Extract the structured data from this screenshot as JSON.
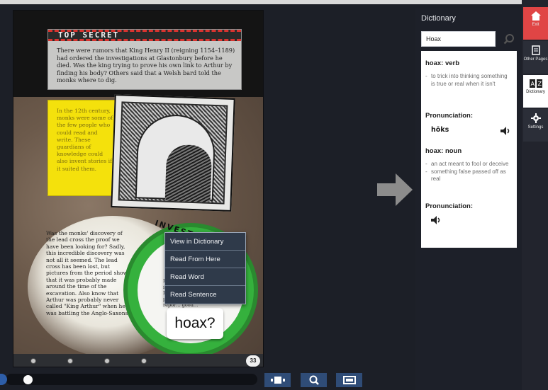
{
  "book": {
    "top_secret_title": "TOP SECRET",
    "top_secret_text": "There were rumors that King Henry II (reigning 1154–1189) had ordered the investigations at Glastonbury before he died. Was the king trying to prove his own link to Arthur by finding his body? Others said that a Welsh bard told the monks where to dig.",
    "sticky_note": "In the 12th century, monks were some of the few people who could read and write. These guardians of knowledge could also invent stories if it suited them.",
    "body_text": "Was the monks' discovery of the lead cross the proof we have been looking for? Sadly, this incredible discovery was not all it seemed. The lead cross has been lost, but pictures from the period show that it was probably made around the time of the excavation. Also know that Arthur was probably never called \"King Arthur\" when he was battling the Anglo-Saxons.",
    "investigation_title": "INVESTIGATION",
    "investigation_lines": "In th… In 11… recen… Disco… was … peopl… repor… good…",
    "selected_word": "hoax?",
    "page_number": "33"
  },
  "context_menu": {
    "items": [
      "View in Dictionary",
      "Read From Here",
      "Read Word",
      "Read Sentence"
    ]
  },
  "dictionary": {
    "title": "Dictionary",
    "search_value": "Hoax",
    "entries": [
      {
        "heading": "hoax: verb",
        "definitions": [
          "to trick into thinking something is true or real when it isn't"
        ],
        "pronunciation_label": "Pronunciation:",
        "pronunciation": "hōks"
      },
      {
        "heading": "hoax: noun",
        "definitions": [
          "an act meant to fool or deceive",
          "something false passed off as real"
        ],
        "pronunciation_label": "Pronunciation:",
        "pronunciation": ""
      }
    ]
  },
  "rail": {
    "exit": "Exit",
    "other_pages": "Other Pages",
    "dictionary": "Dictionary",
    "settings": "Settings"
  },
  "reader_progress": 0.05,
  "colors": {
    "exit_red": "#e04545",
    "toolbar_blue": "#2f4c77",
    "invest_green": "#35b13d",
    "note_yellow": "#f4e10c"
  }
}
